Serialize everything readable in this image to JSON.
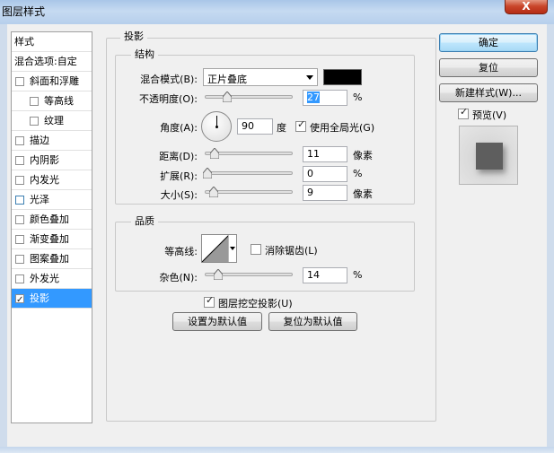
{
  "window": {
    "title": "图层样式",
    "close_label": "X"
  },
  "style_list": {
    "header": "样式",
    "blend_options": "混合选项:自定",
    "items": [
      {
        "label": "斜面和浮雕",
        "checked": false
      },
      {
        "label": "等高线",
        "checked": false,
        "sub": true
      },
      {
        "label": "纹理",
        "checked": false,
        "sub": true
      },
      {
        "label": "描边",
        "checked": false
      },
      {
        "label": "内阴影",
        "checked": false
      },
      {
        "label": "内发光",
        "checked": false
      },
      {
        "label": "光泽",
        "checked": false
      },
      {
        "label": "颜色叠加",
        "checked": false
      },
      {
        "label": "渐变叠加",
        "checked": false
      },
      {
        "label": "图案叠加",
        "checked": false
      },
      {
        "label": "外发光",
        "checked": false
      },
      {
        "label": "投影",
        "checked": true,
        "selected": true
      }
    ]
  },
  "drop_shadow": {
    "section_title": "投影",
    "structure": {
      "title": "结构",
      "blend_mode_label": "混合模式(B):",
      "blend_mode_value": "正片叠底",
      "blend_color": "#000000",
      "opacity_label": "不透明度(O):",
      "opacity_value": "27",
      "opacity_unit": "%",
      "angle_label": "角度(A):",
      "angle_value": "90",
      "angle_unit": "度",
      "global_light_label": "使用全局光(G)",
      "global_light_checked": true,
      "distance_label": "距离(D):",
      "distance_value": "11",
      "distance_unit": "像素",
      "spread_label": "扩展(R):",
      "spread_value": "0",
      "spread_unit": "%",
      "size_label": "大小(S):",
      "size_value": "9",
      "size_unit": "像素"
    },
    "quality": {
      "title": "品质",
      "contour_label": "等高线:",
      "anti_alias_label": "消除锯齿(L)",
      "anti_alias_checked": false,
      "noise_label": "杂色(N):",
      "noise_value": "14",
      "noise_unit": "%"
    },
    "knockout_label": "图层挖空投影(U)",
    "knockout_checked": true,
    "make_default_label": "设置为默认值",
    "reset_default_label": "复位为默认值"
  },
  "buttons": {
    "ok": "确定",
    "reset": "复位",
    "new_style": "新建样式(W)...",
    "preview_label": "预览(V)",
    "preview_checked": true
  }
}
